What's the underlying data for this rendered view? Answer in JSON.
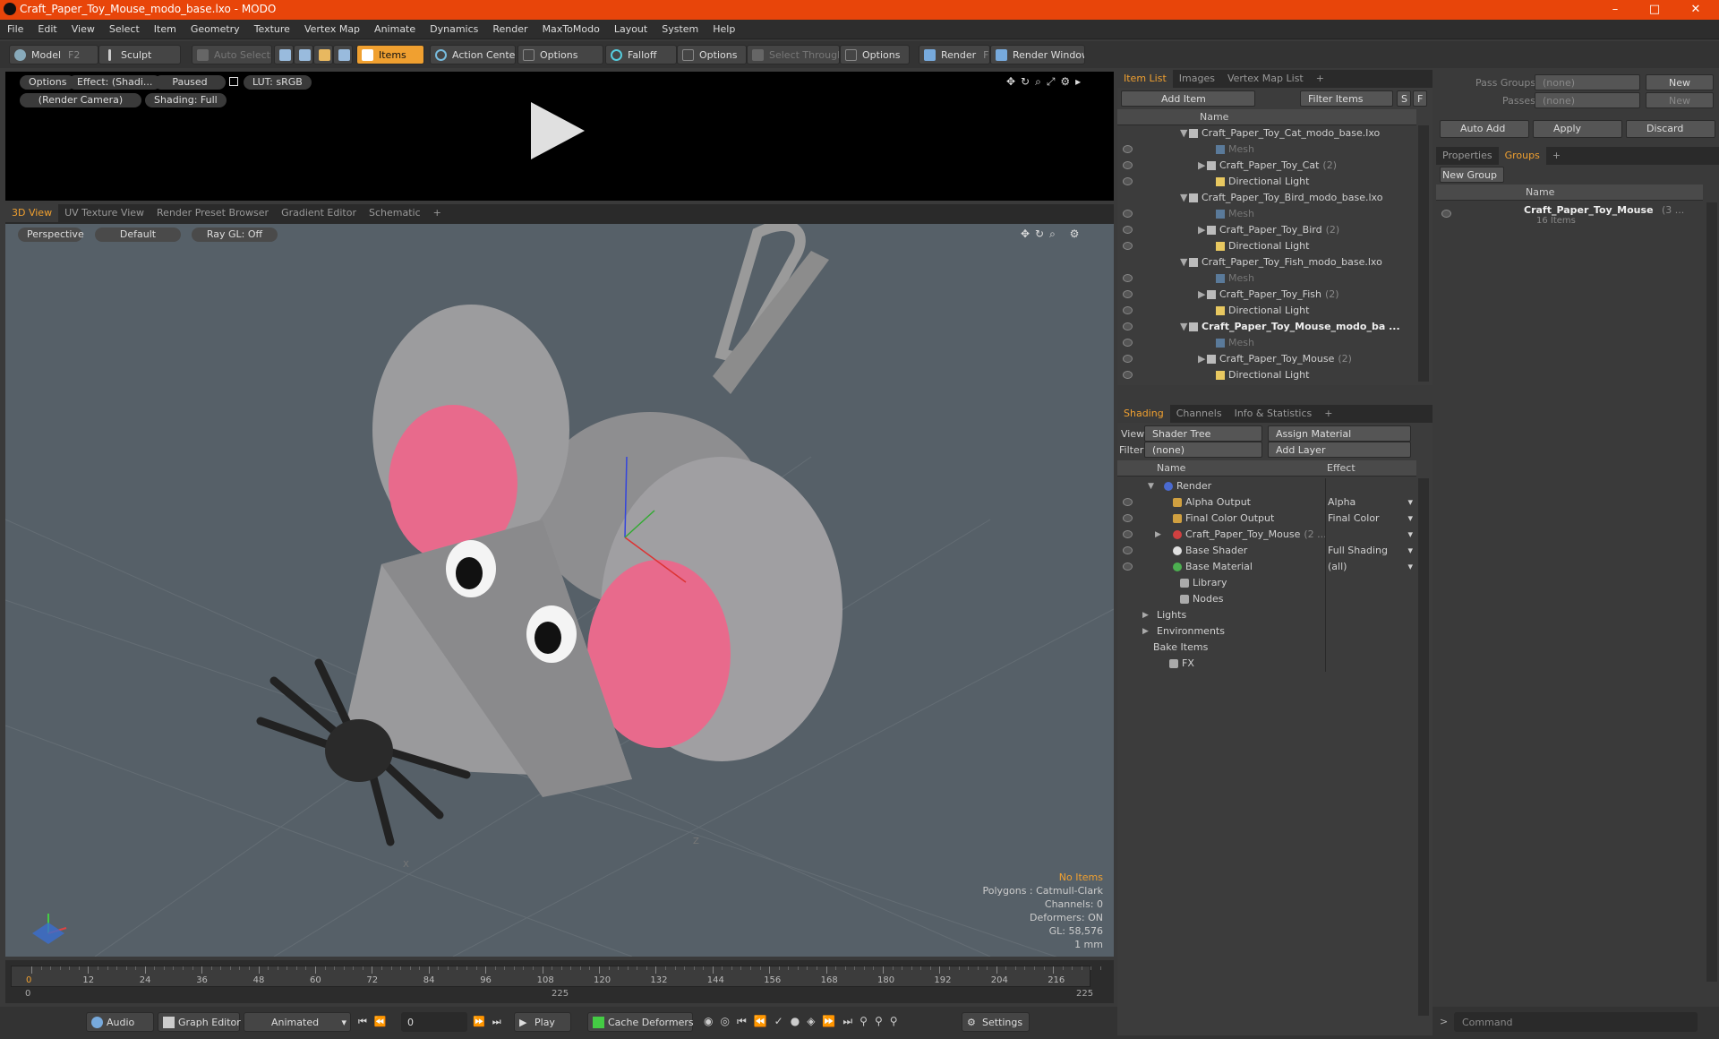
{
  "window": {
    "title": "Craft_Paper_Toy_Mouse_modo_base.lxo - MODO",
    "min": "–",
    "max": "□",
    "close": "✕"
  },
  "menu": [
    "File",
    "Edit",
    "View",
    "Select",
    "Item",
    "Geometry",
    "Texture",
    "Vertex Map",
    "Animate",
    "Dynamics",
    "Render",
    "MaxToModo",
    "Layout",
    "System",
    "Help"
  ],
  "toolbar": {
    "model": "Model",
    "model_key": "F2",
    "sculpt": "Sculpt",
    "auto_select": "Auto Select",
    "items": "Items",
    "action_center": "Action Center",
    "options1": "Options",
    "falloff": "Falloff",
    "options2": "Options",
    "select_through": "Select Through",
    "options3": "Options",
    "render": "Render",
    "render_key": "F9",
    "render_window": "Render Window"
  },
  "preview": {
    "options": "Options",
    "effect": "Effect: (Shadi...",
    "paused": "Paused",
    "lut": "LUT: sRGB",
    "camera": "(Render Camera)",
    "shading": "Shading: Full"
  },
  "viewport_tabs": [
    "3D View",
    "UV Texture View",
    "Render Preset Browser",
    "Gradient Editor",
    "Schematic",
    "+"
  ],
  "viewport": {
    "perspective": "Perspective",
    "default": "Default",
    "raygl": "Ray GL: Off",
    "no_items": "No Items",
    "polygons": "Polygons : Catmull-Clark",
    "channels": "Channels: 0",
    "deformers": "Deformers: ON",
    "gl": "GL: 58,576",
    "unit": "1 mm",
    "axis_x": "X",
    "axis_z": "Z"
  },
  "timeline": {
    "ticks": [
      "0",
      "12",
      "24",
      "36",
      "48",
      "60",
      "72",
      "84",
      "96",
      "108",
      "120",
      "132",
      "144",
      "156",
      "168",
      "180",
      "192",
      "204",
      "216"
    ],
    "start": "0",
    "mid": "225",
    "end": "225"
  },
  "bottom": {
    "audio": "Audio",
    "graph_editor": "Graph Editor",
    "animated": "Animated",
    "frame": "0",
    "play": "Play",
    "cache": "Cache Deformers",
    "settings": "Settings",
    "command": "Command"
  },
  "itemlist": {
    "tabs": [
      "Item List",
      "Images",
      "Vertex Map List",
      "+"
    ],
    "add_item": "Add Item",
    "filter": "Filter Items",
    "s": "S",
    "f": "F",
    "col_name": "Name",
    "rows": [
      {
        "label": "Craft_Paper_Toy_Cat_modo_base.lxo",
        "indent": 0,
        "type": "scene",
        "bold": false,
        "count": ""
      },
      {
        "label": "Mesh",
        "indent": 2,
        "type": "mesh",
        "bold": false,
        "count": "",
        "gray": true
      },
      {
        "label": "Craft_Paper_Toy_Cat",
        "indent": 2,
        "type": "group",
        "bold": false,
        "count": "(2)"
      },
      {
        "label": "Directional Light",
        "indent": 2,
        "type": "light",
        "bold": false,
        "count": ""
      },
      {
        "label": "Craft_Paper_Toy_Bird_modo_base.lxo",
        "indent": 0,
        "type": "scene",
        "bold": false,
        "count": ""
      },
      {
        "label": "Mesh",
        "indent": 2,
        "type": "mesh",
        "bold": false,
        "count": "",
        "gray": true
      },
      {
        "label": "Craft_Paper_Toy_Bird",
        "indent": 2,
        "type": "group",
        "bold": false,
        "count": "(2)"
      },
      {
        "label": "Directional Light",
        "indent": 2,
        "type": "light",
        "bold": false,
        "count": ""
      },
      {
        "label": "Craft_Paper_Toy_Fish_modo_base.lxo",
        "indent": 0,
        "type": "scene",
        "bold": false,
        "count": ""
      },
      {
        "label": "Mesh",
        "indent": 2,
        "type": "mesh",
        "bold": false,
        "count": "",
        "gray": true
      },
      {
        "label": "Craft_Paper_Toy_Fish",
        "indent": 2,
        "type": "group",
        "bold": false,
        "count": "(2)"
      },
      {
        "label": "Directional Light",
        "indent": 2,
        "type": "light",
        "bold": false,
        "count": ""
      },
      {
        "label": "Craft_Paper_Toy_Mouse_modo_ba ...",
        "indent": 0,
        "type": "scene",
        "bold": true,
        "count": ""
      },
      {
        "label": "Mesh",
        "indent": 2,
        "type": "mesh",
        "bold": false,
        "count": "",
        "gray": true
      },
      {
        "label": "Craft_Paper_Toy_Mouse",
        "indent": 2,
        "type": "group",
        "bold": false,
        "count": "(2)"
      },
      {
        "label": "Directional Light",
        "indent": 2,
        "type": "light",
        "bold": false,
        "count": ""
      }
    ]
  },
  "shading": {
    "tabs": [
      "Shading",
      "Channels",
      "Info & Statistics",
      "+"
    ],
    "view_label": "View",
    "view_value": "Shader Tree",
    "assign": "Assign Material",
    "filter_label": "Filter",
    "filter_value": "(none)",
    "add_layer": "Add Layer",
    "col_name": "Name",
    "col_effect": "Effect",
    "rows": [
      {
        "label": "Render",
        "effect": "",
        "eye": false
      },
      {
        "label": "Alpha Output",
        "effect": "Alpha",
        "eye": true
      },
      {
        "label": "Final Color Output",
        "effect": "Final Color",
        "eye": true
      },
      {
        "label": "Craft_Paper_Toy_Mouse",
        "effect": "",
        "eye": true,
        "count": "(2 ..."
      },
      {
        "label": "Base Shader",
        "effect": "Full Shading",
        "eye": true
      },
      {
        "label": "Base Material",
        "effect": "(all)",
        "eye": true
      },
      {
        "label": "Library",
        "effect": "",
        "eye": false
      },
      {
        "label": "Nodes",
        "effect": "",
        "eye": false
      },
      {
        "label": "Lights",
        "effect": "",
        "eye": false
      },
      {
        "label": "Environments",
        "effect": "",
        "eye": false
      },
      {
        "label": "Bake Items",
        "effect": "",
        "eye": false
      },
      {
        "label": "FX",
        "effect": "",
        "eye": false
      }
    ]
  },
  "groups": {
    "pass_groups": "Pass Groups",
    "passes": "Passes",
    "none1": "(none)",
    "none2": "(none)",
    "new1": "New",
    "new2": "New",
    "auto_add": "Auto Add",
    "apply": "Apply",
    "discard": "Discard",
    "tabs": [
      "Properties",
      "Groups",
      "+"
    ],
    "new_group": "New Group",
    "col_name": "Name",
    "item_name": "Craft_Paper_Toy_Mouse",
    "item_count": "(3 ...",
    "item_sub": "16 Items"
  },
  "colors": {
    "accent": "#f0a030",
    "title": "#e8450a",
    "viewport": "#566068"
  }
}
